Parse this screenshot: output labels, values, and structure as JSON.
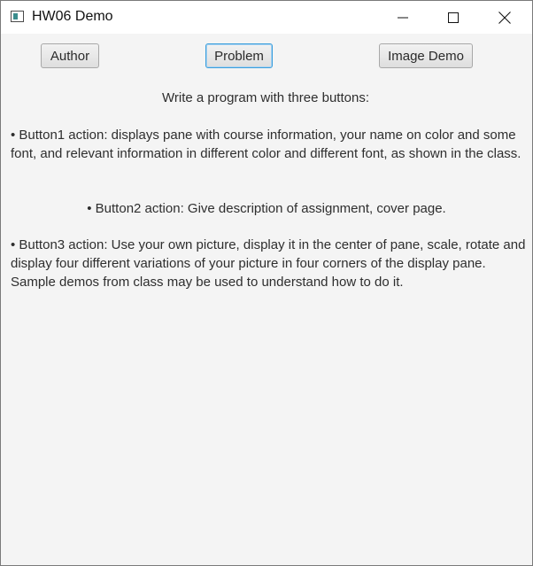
{
  "window": {
    "title": "HW06 Demo"
  },
  "toolbar": {
    "author_label": "Author",
    "problem_label": "Problem",
    "image_demo_label": "Image Demo"
  },
  "problem": {
    "intro": "Write a program with three buttons:",
    "button1": "• Button1 action: displays pane with course information, your name on color and some font, and relevant information in different color  and different font, as shown in the class.",
    "button2": "• Button2 action: Give description of assignment, cover page.",
    "button3": "• Button3 action: Use your own picture, display it in the center of pane, scale, rotate and display four different variations  of your picture in four corners of the display pane. Sample demos from class may be used to understand how to do it."
  },
  "colors": {
    "focus_accent": "#3c9fdc",
    "app_icon": "#3a8c8c"
  }
}
